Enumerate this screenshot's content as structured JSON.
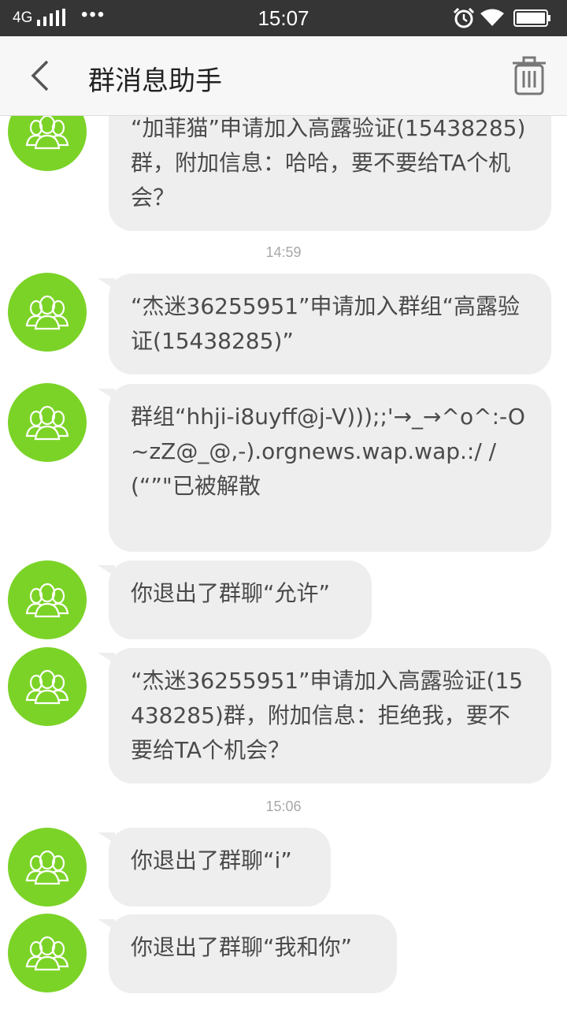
{
  "status_bar": {
    "network": "4G",
    "dots": "•••",
    "time": "15:07",
    "icons": [
      "signal-icon",
      "alarm-icon",
      "wifi-icon",
      "battery-icon"
    ]
  },
  "header": {
    "title": "群消息助手",
    "back_icon": "back-chevron-icon",
    "delete_icon": "trash-icon"
  },
  "colors": {
    "avatar_green": "#7bd327",
    "bubble_bg": "#eeeeee",
    "status_bar_bg": "#353535",
    "header_bg": "#f7f7f7"
  },
  "messages": [
    {
      "type": "message",
      "text": "“加菲猫”申请加入高露验证(15438285)群，附加信息：哈哈，要不要给TA个机会？"
    },
    {
      "type": "time",
      "text": "14:59"
    },
    {
      "type": "message",
      "text": "“杰迷36255951”申请加入群组“高露验证(15438285)”"
    },
    {
      "type": "message",
      "text": "群组“hhji-i8uyff@j-V)));;'→_→^o^:-O~zZ@_@,-).orgnews.wap.wap.:/ /(“”\"已被解散"
    },
    {
      "type": "message",
      "text": "你退出了群聊“允许”"
    },
    {
      "type": "message",
      "text": "“杰迷36255951”申请加入高露验证(15438285)群，附加信息：拒绝我，要不要给TA个机会？"
    },
    {
      "type": "time",
      "text": "15:06"
    },
    {
      "type": "message",
      "text": "你退出了群聊“i”"
    },
    {
      "type": "message",
      "text": "你退出了群聊“我和你”"
    }
  ]
}
